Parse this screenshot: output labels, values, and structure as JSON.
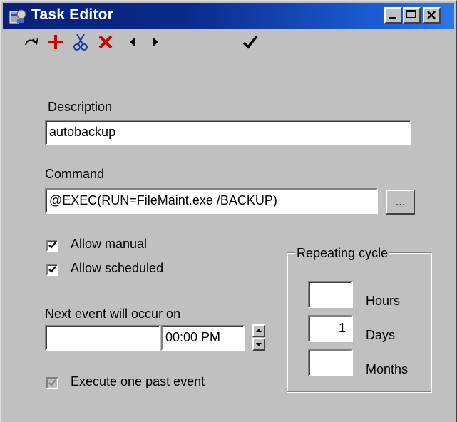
{
  "window": {
    "title": "Task Editor"
  },
  "toolbar": {
    "icons": [
      "redo-icon",
      "add-icon",
      "cut-icon",
      "delete-icon",
      "previous-icon",
      "next-icon",
      "check-icon"
    ]
  },
  "form": {
    "description_label": "Description",
    "description_value": "autobackup",
    "command_label": "Command",
    "command_value": "@EXEC(RUN=FileMaint.exe /BACKUP)",
    "browse_label": "...",
    "allow_manual_label": "Allow manual",
    "allow_manual_checked": true,
    "allow_scheduled_label": "Allow scheduled",
    "allow_scheduled_checked": true,
    "next_event_label": "Next event will occur on",
    "next_event_date": "",
    "next_event_time": "00:00 PM",
    "execute_past_label": "Execute one past event",
    "execute_past_checked": true
  },
  "repeating": {
    "title": "Repeating cycle",
    "hours_label": "Hours",
    "hours_value": "",
    "days_label": "Days",
    "days_value": "1",
    "months_label": "Months",
    "months_value": ""
  },
  "colors": {
    "titlebar_start": "#08207a",
    "titlebar_end": "#2a78e8",
    "face": "#c0c0c0",
    "toolbar_red": "#cc0000",
    "toolbar_blue": "#1a3aa8"
  }
}
